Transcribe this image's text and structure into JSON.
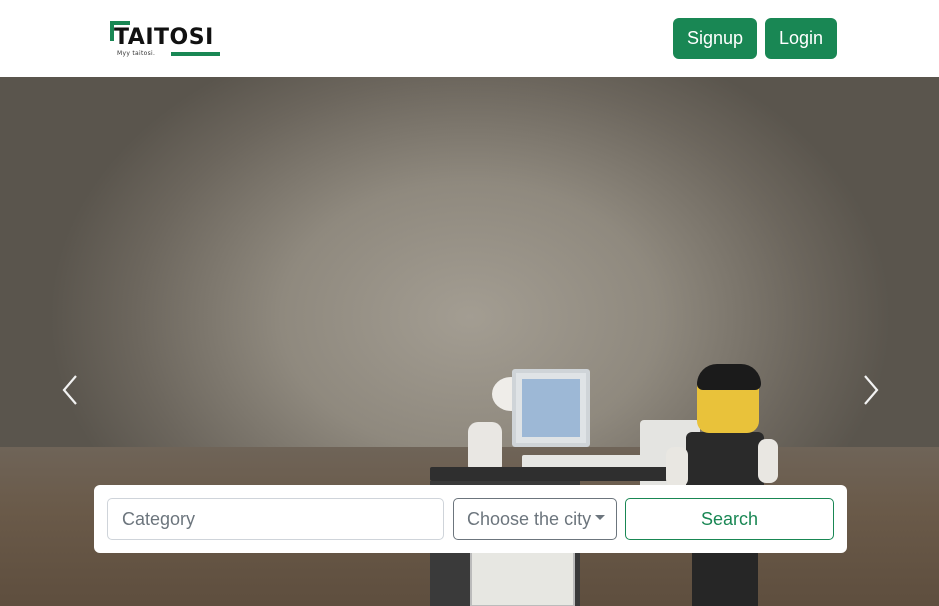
{
  "header": {
    "logo_text": "TAITOSI",
    "logo_tagline": "Myy taitosi.",
    "signup_label": "Signup",
    "login_label": "Login"
  },
  "hero": {
    "carousel_prev_icon": "chevron-left-icon",
    "carousel_next_icon": "chevron-right-icon"
  },
  "search": {
    "category_placeholder": "Category",
    "city_label": "Choose the city",
    "search_label": "Search"
  },
  "colors": {
    "brand_green": "#198754",
    "text_muted": "#6c757d"
  }
}
